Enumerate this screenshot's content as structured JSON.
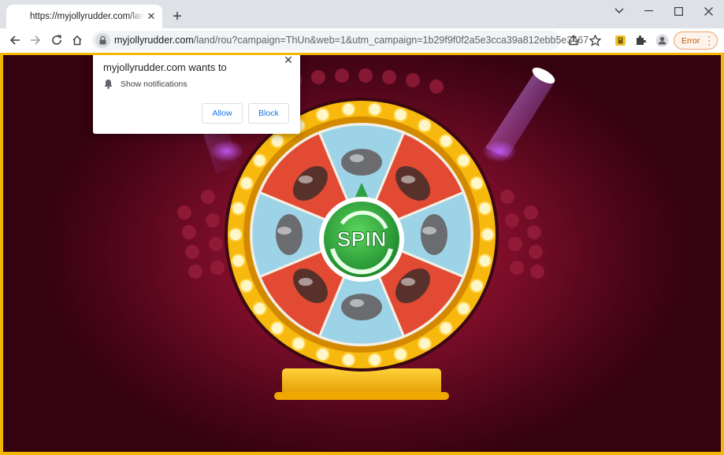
{
  "browser": {
    "tab_title": "https://myjollyrudder.com/land/rou?campaign=ThUn",
    "url_host": "myjollyrudder.com",
    "url_path": "/land/rou?campaign=ThUn&web=1&utm_campaign=1b29f9f0f2a5e3cca39a812ebb5e3467",
    "error_label": "Error"
  },
  "permission_prompt": {
    "title": "myjollyrudder.com wants to",
    "permission_label": "Show notifications",
    "allow_label": "Allow",
    "block_label": "Block"
  },
  "wheel": {
    "center_label": "SPIN",
    "segments": [
      {
        "icon": "car-icon",
        "color": "#9dd3e6"
      },
      {
        "icon": "scooter-icon",
        "color": "#e24a33"
      },
      {
        "icon": "smartphone-icon",
        "color": "#9dd3e6"
      },
      {
        "icon": "champagne-icon",
        "color": "#e24a33"
      },
      {
        "icon": "coffee-machine-icon",
        "color": "#9dd3e6"
      },
      {
        "icon": "helmet-icon",
        "color": "#e24a33"
      },
      {
        "icon": "gift-box-icon",
        "color": "#9dd3e6"
      },
      {
        "icon": "phone-case-icon",
        "color": "#e24a33"
      }
    ]
  },
  "colors": {
    "page_border": "#f2b705",
    "stage_dark": "#4a0519",
    "wheel_rim": "#f5b50a",
    "spin_green": "#2ea043",
    "link_blue": "#1a73e8"
  }
}
